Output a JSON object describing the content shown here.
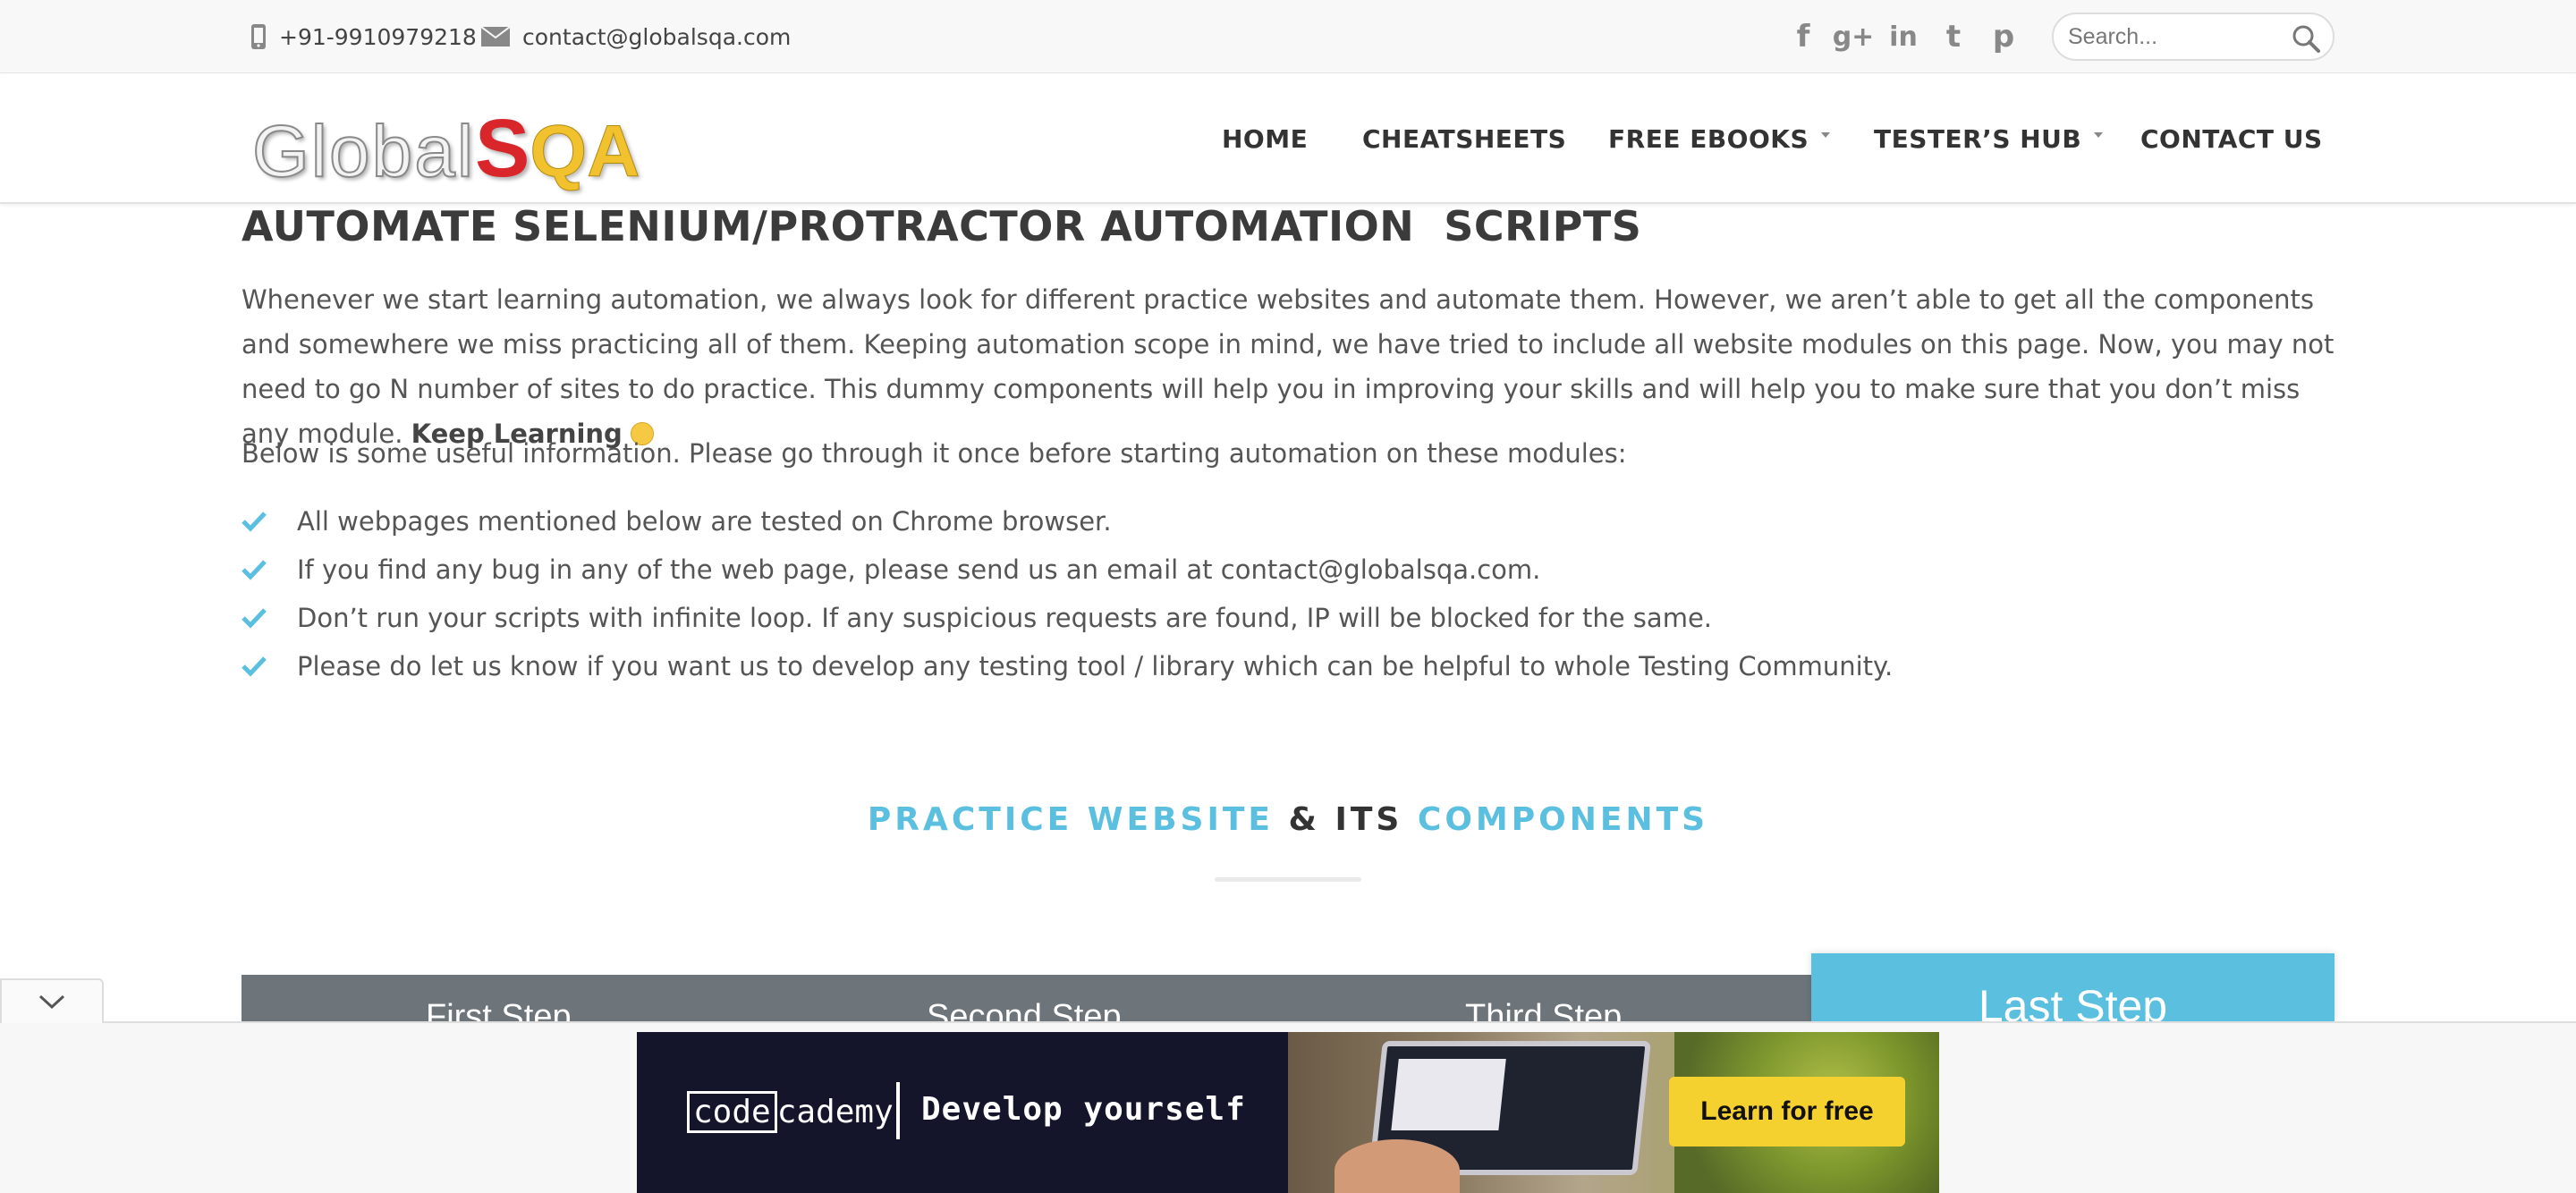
{
  "topbar": {
    "phone": "+91-9910979218",
    "email": "contact@globalsqa.com",
    "social": [
      {
        "icon": "facebook-icon",
        "glyph": "f"
      },
      {
        "icon": "google-plus-icon",
        "glyph": "g+"
      },
      {
        "icon": "linkedin-icon",
        "glyph": "in"
      },
      {
        "icon": "twitter-icon",
        "glyph": "t"
      },
      {
        "icon": "pinterest-icon",
        "glyph": "p"
      }
    ],
    "search_placeholder": "Search..."
  },
  "header": {
    "logo": {
      "part1": "Global",
      "part2": "S",
      "part3": "QA"
    },
    "nav": {
      "home": "HOME",
      "cheatsheets": "CHEATSHEETS",
      "free_ebooks": "FREE EBOOKS",
      "testers_hub": "TESTER’S HUB",
      "contact_us": "CONTACT US"
    }
  },
  "main": {
    "title": "AUTOMATE SELENIUM/PROTRACTOR AUTOMATION  SCRIPTS",
    "intro": "Whenever we start learning automation, we always look for different practice websites and automate them. However, we aren’t able to get all the components and somewhere we miss practicing all of them. Keeping automation scope in mind, we have tried to include all website modules on this page. Now, you may not need to go N number of sites to do practice. This dummy components will help you in improving your skills and will help you to make sure that you don’t miss any module.",
    "intro_bold": "Keep Learning",
    "info_heading": "Below is some useful information. Please go through it once before starting automation on these modules:",
    "checklist": [
      "All webpages mentioned below are tested on Chrome browser.",
      "If you find any bug in any of the web page, please send us an email at contact@globalsqa.com.",
      "Don’t run your scripts with infinite loop. If any suspicious requests are found, IP will be blocked for the same.",
      "Please do let us know if you want us to develop any testing tool / library which can be helpful to whole Testing Community."
    ],
    "section_title": {
      "part1": "PRACTICE WEBSITE",
      "part2": "& ITS",
      "part3": "COMPONENTS"
    },
    "steps": [
      "First Step",
      "Second Step",
      "Third Step"
    ],
    "last_step": "Last Step"
  },
  "ad": {
    "brand_code": "code",
    "brand_rest": "cademy",
    "tagline": "Develop yourself",
    "cta": "Learn for free"
  },
  "colors": {
    "accent": "#5bbfe0",
    "steps_bg": "#6e757a",
    "logo_s": "#d8262a",
    "logo_qa": "#f2c12e",
    "ad_bg": "#14142b",
    "ad_cta": "#f5d12f"
  }
}
